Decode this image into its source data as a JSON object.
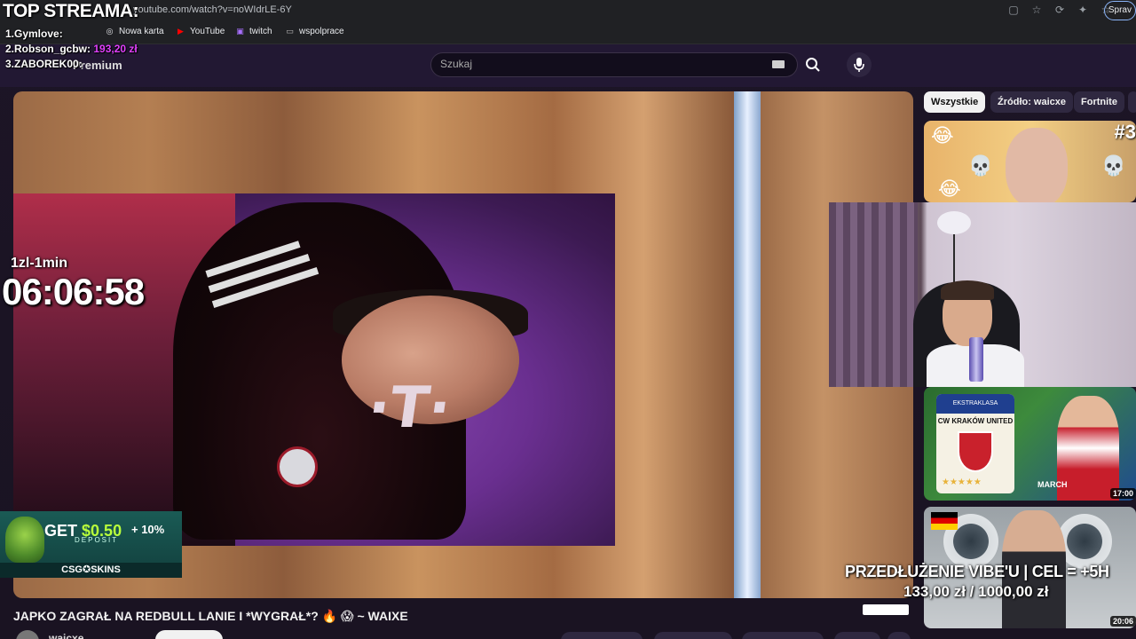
{
  "browser": {
    "url": "youtube.com/watch?v=noWIdrLE-6Y",
    "profile_label": "Sprav",
    "bookmarks": [
      {
        "label": "Nowa karta",
        "icon": "globe-icon"
      },
      {
        "label": "YouTube",
        "icon": "youtube-icon"
      },
      {
        "label": "twitch",
        "icon": "twitch-icon"
      },
      {
        "label": "wspolprace",
        "icon": "folder-icon"
      }
    ]
  },
  "youtube": {
    "premium_label": "Premium",
    "search_placeholder": "Szukaj",
    "chips": [
      "Wszystkie",
      "Źródło: waicxe",
      "Fortnite"
    ],
    "video_title": "JAPKO ZAGRAŁ NA REDBULL LANIE I *WYGRAŁ*? 🔥 😱 ~ WAIXE",
    "channel_name": "waicxe",
    "sidebar_durations": [
      "17:00",
      "20:06"
    ],
    "thumbnail_texts": {
      "episode_number": "#3",
      "ekstraklasa": "EKSTRAKLASA",
      "club": "CW KRAKÓW UNITED",
      "march": "MARCH"
    }
  },
  "overlay": {
    "top_title": "TOP STREAMA:",
    "top_list": [
      {
        "rank_name": "1.Gymlove:",
        "amount": ""
      },
      {
        "rank_name": "2.Robson_gcbw:",
        "amount": "193,20 zł"
      },
      {
        "rank_name": "3.ZABOREK00:",
        "amount": ""
      }
    ],
    "rate_label": "1zl-1min",
    "timer": "06:06:58",
    "goal_title": "PRZEDŁUŻENIE VIBE'U | CEL = +5H",
    "goal_amount": "133,00 zł  / 1000,00 zł",
    "ad": {
      "get": "GET",
      "money": "$0.50",
      "percent": "+ 10%",
      "deposit": "DEPOSIT",
      "brand": "CSG✪SKINS"
    }
  },
  "colors": {
    "accent_magenta": "#e040fb",
    "chip_active_bg": "#f1f1f1",
    "page_bg": "#1a1322"
  }
}
